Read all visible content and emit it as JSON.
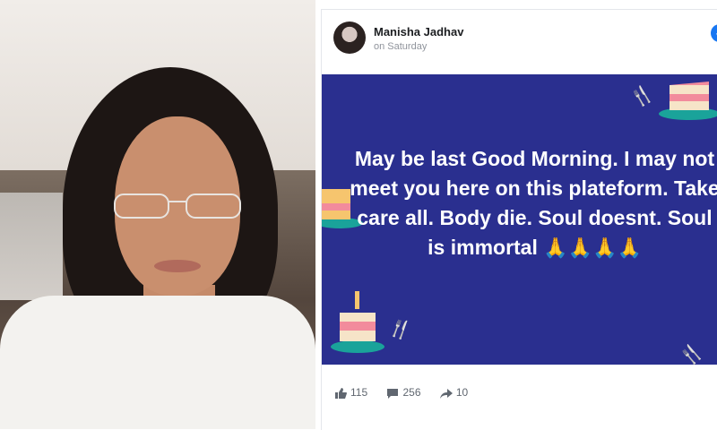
{
  "post": {
    "author": "Manisha Jadhav",
    "time": "on Saturday",
    "message": "May be last Good Morning. I may not meet you here on this plateform. Take care all. Body die. Soul doesnt. Soul is immortal",
    "emoji": "🙏🙏🙏🙏"
  },
  "stats": {
    "likes": "115",
    "comments": "256",
    "shares": "10"
  },
  "colors": {
    "banner": "#2a2f8f",
    "text": "#ffffff",
    "brand": "#1877f2"
  }
}
